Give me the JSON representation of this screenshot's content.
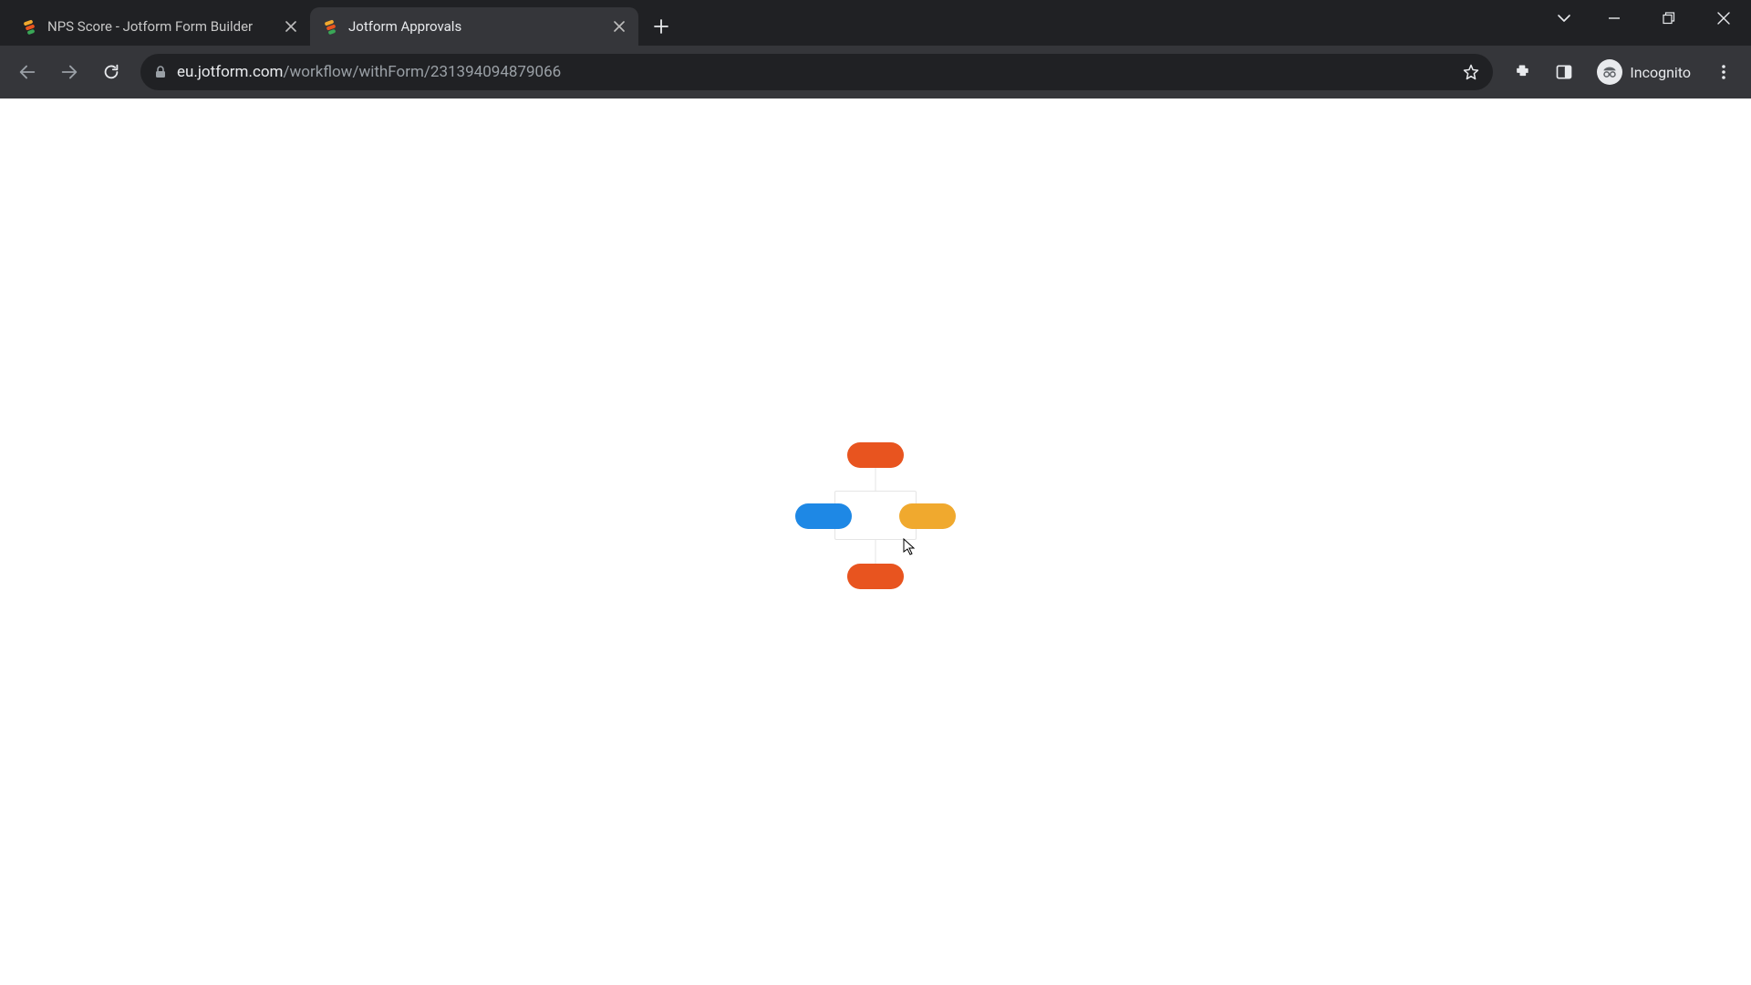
{
  "browser": {
    "tabs": [
      {
        "title": "NPS Score - Jotform Form Builder",
        "active": false
      },
      {
        "title": "Jotform Approvals",
        "active": true
      }
    ],
    "url": {
      "host": "eu.jotform.com",
      "path": "/workflow/withForm/231394094879066"
    },
    "incognito_label": "Incognito"
  },
  "loader": {
    "colors": {
      "orange": "#e8541f",
      "blue": "#1e88e5",
      "yellow": "#f0a92e"
    }
  }
}
